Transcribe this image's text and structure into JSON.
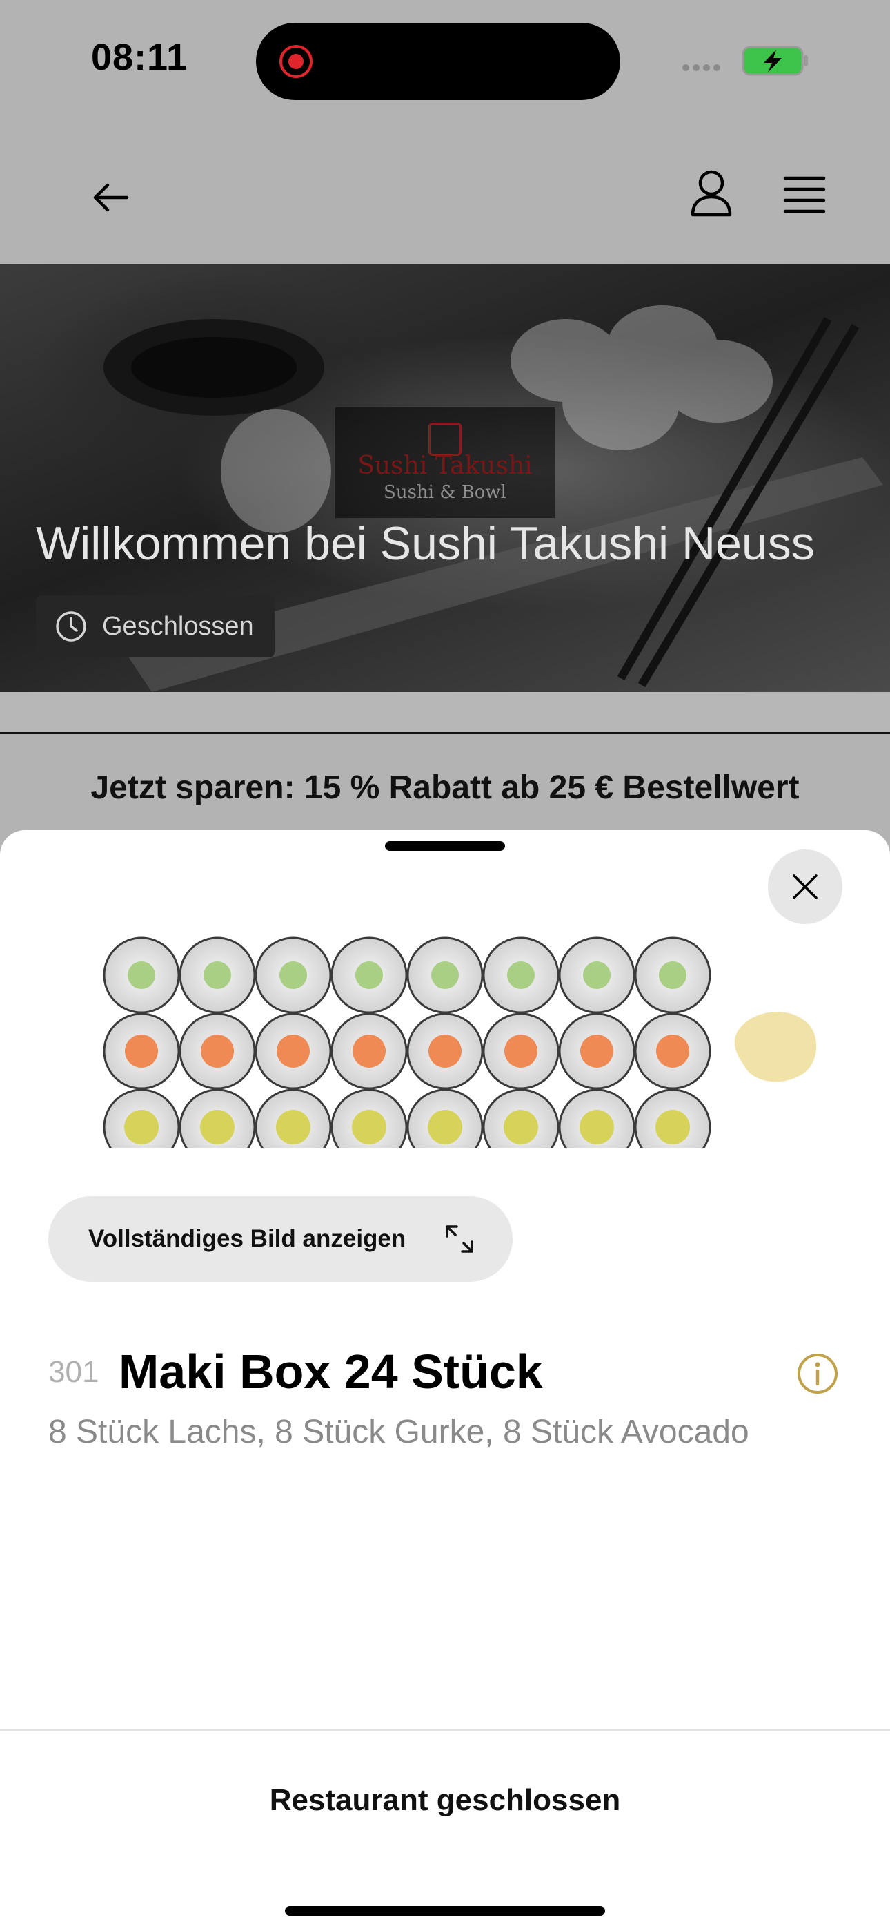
{
  "status_bar": {
    "time": "08:11",
    "battery_color": "#3dc34a",
    "recording_color": "#e0242c"
  },
  "nav": {
    "back_icon": "arrow-left-icon",
    "account_icon": "user-icon",
    "menu_icon": "hamburger-menu-icon"
  },
  "hero": {
    "logo_brand": "Sushi Takushi",
    "logo_sub": "Sushi & Bowl",
    "title": "Willkommen bei Sushi Takushi Neuss",
    "status": "Geschlossen",
    "status_icon": "clock-icon"
  },
  "promo": {
    "text": "Jetzt sparen: 15 % Rabatt ab 25 € Bestellwert"
  },
  "product": {
    "full_image_label": "Vollständiges Bild anzeigen",
    "expand_icon": "expand-arrows-icon",
    "number": "301",
    "name": "Maki Box 24 Stück",
    "description": "8 Stück Lachs, 8 Stück Gurke, 8 Stück Avocado",
    "info_icon": "info-icon",
    "accent_color": "#c0a24a"
  },
  "footer": {
    "status_label": "Restaurant geschlossen"
  }
}
